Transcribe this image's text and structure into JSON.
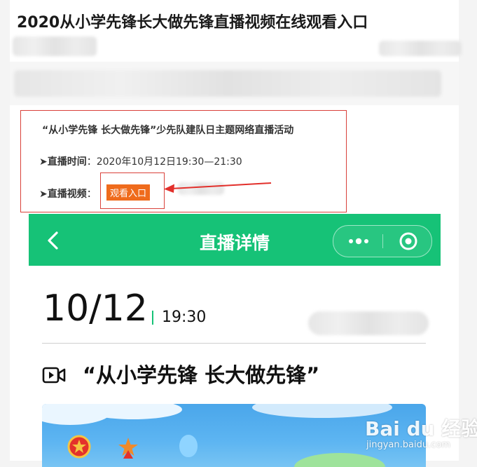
{
  "article": {
    "title": "2020从小学先锋长大做先锋直播视频在线观看入口"
  },
  "info_box": {
    "title": "“从小学先锋 长大做先锋”少先队建队日主题网络直播活动",
    "time_label": "➤直播时间",
    "time_value": "：2020年10月12日19:30—21:30",
    "video_label": "➤直播视频",
    "video_colon": "：",
    "watch_button": "观看入口"
  },
  "mini_program": {
    "header_title": "直播详情",
    "date": "10/12",
    "time": "19:30",
    "event_title": "“从小学先锋 长大做先锋”",
    "colors": {
      "header_bg": "#16c277",
      "accent": "#16c277",
      "button_orange": "#ef6b1c",
      "annotation_red": "#d9413a"
    }
  },
  "watermark": {
    "main": "Bai du 经验",
    "sub": "jingyan.baidu.com"
  },
  "icons": [
    "back-chevron-icon",
    "more-dots-icon",
    "close-target-icon",
    "video-camera-icon",
    "red-arrow-icon"
  ]
}
